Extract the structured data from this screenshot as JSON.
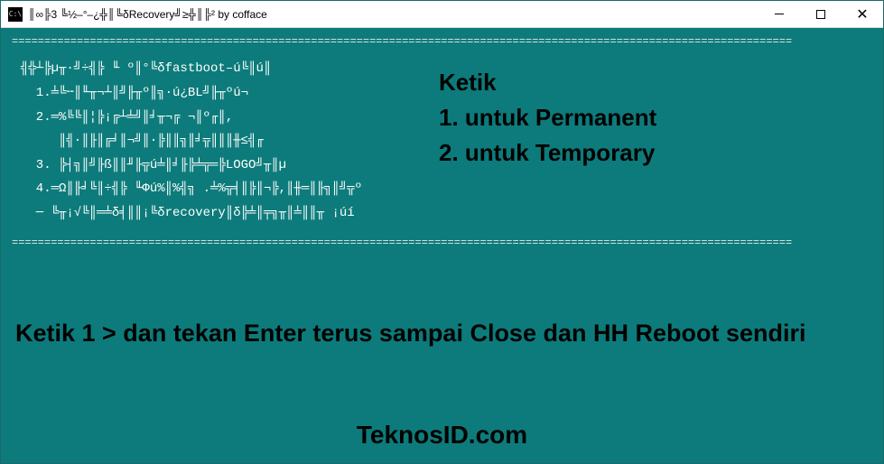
{
  "titlebar": {
    "title": "║∞╠3 ╚½–°–¿╬║╚δRecovery╝≥╬║╠² by cofface"
  },
  "console": {
    "divider": "========================================================================================================================",
    "lines": [
      "╣╬┴╠µ╥·╝÷╣╠ ╙ º║°╚δfastboot–ú╚║ú║",
      "  1.╧╚╌║╙╥¬┴║╝╟╥º║╗·ú¿BL╝╟╥ºú¬",
      "  2.═%╚╚║¦╠¡╔┴╧╝║╛╥¬╔ ¬║º╓║,",
      "     ║╣·║╟║╔╛║¬╝║·╠║║╗║╛╦║║║╫≤╣╓",
      "  3. ╠┤╗║╝╟ß║║╜╟╦ú╧║╛╟╠╧╦═╠LOGO╝╥║µ",
      "  4.═Ω║╟╛╚║÷╣╠ ╙Φú%║%╣╗ .╧%╦╡║╠║¬╠,║╫═║╟╗║╝╦º",
      "  ─ ╚╥¡√╚║═╧δ╡║║¡╚δrecovery║δ╠╧║╤╗╥║╧║║╥ ¡úí"
    ]
  },
  "overlay": {
    "heading": "Ketik",
    "option1": "1. untuk Permanent",
    "option2": "2. untuk Temporary",
    "main_instruction": "Ketik 1 > dan tekan Enter terus sampai Close dan HH Reboot sendiri",
    "brand": "TeknosID.com"
  }
}
